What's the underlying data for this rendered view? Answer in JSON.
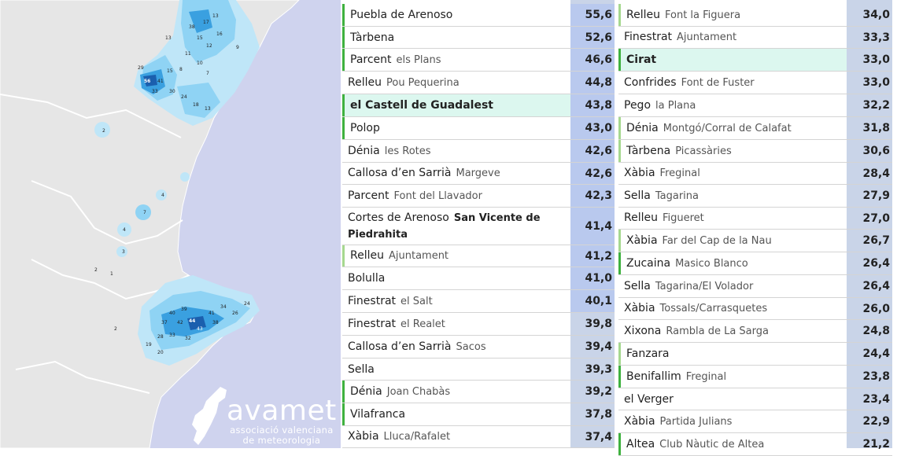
{
  "logo": {
    "name": "avamet",
    "subtitle_1": "associació valenciana",
    "subtitle_2": "de meteorologia"
  },
  "colors": {
    "map_bg": "#cfd3ee",
    "land": "#e6e6e6",
    "rain_light": "#8fd3f4",
    "rain_mid": "#3aa0e0",
    "rain_dark": "#1b5fae",
    "row_highlight": "#dcf7ef",
    "value_col": "#c9d4e8",
    "marker_green": "#3fb13f",
    "marker_light_green": "#a6d88f"
  },
  "left_rows": [
    {
      "name": "Puebla de Arenoso",
      "station": "",
      "value": "55,6",
      "marker": "green",
      "highlight": false,
      "bold": false
    },
    {
      "name": "Tàrbena",
      "station": "",
      "value": "52,6",
      "marker": "green",
      "highlight": false,
      "bold": false
    },
    {
      "name": "Parcent",
      "station": "els Plans",
      "value": "46,6",
      "marker": "green",
      "highlight": false,
      "bold": false
    },
    {
      "name": "Relleu",
      "station": "Pou Pequerina",
      "value": "44,8",
      "marker": "none",
      "highlight": false,
      "bold": false
    },
    {
      "name": "el Castell de Guadalest",
      "station": "",
      "value": "43,8",
      "marker": "green",
      "highlight": true,
      "bold": true
    },
    {
      "name": "Polop",
      "station": "",
      "value": "43,0",
      "marker": "green",
      "highlight": false,
      "bold": false
    },
    {
      "name": "Dénia",
      "station": "les Rotes",
      "value": "42,6",
      "marker": "none",
      "highlight": false,
      "bold": false
    },
    {
      "name": "Callosa d’en Sarrià",
      "station": "Margeve",
      "value": "42,6",
      "marker": "none",
      "highlight": false,
      "bold": false
    },
    {
      "name": "Parcent",
      "station": "Font del Llavador",
      "value": "42,3",
      "marker": "none",
      "highlight": false,
      "bold": false
    },
    {
      "name": "Cortes de Arenoso",
      "station": "San Vicente de Piedrahita",
      "value": "41,4",
      "marker": "none",
      "highlight": false,
      "bold": false,
      "station_bold": true
    },
    {
      "name": "Relleu",
      "station": "Ajuntament",
      "value": "41,2",
      "marker": "lgreen",
      "highlight": false,
      "bold": false
    },
    {
      "name": "Bolulla",
      "station": "",
      "value": "41,0",
      "marker": "none",
      "highlight": false,
      "bold": false
    },
    {
      "name": "Finestrat",
      "station": "el Salt",
      "value": "40,1",
      "marker": "none",
      "highlight": false,
      "bold": false
    },
    {
      "name": "Finestrat",
      "station": "el Realet",
      "value": "39,8",
      "marker": "none",
      "highlight": false,
      "bold": false
    },
    {
      "name": "Callosa d’en Sarrià",
      "station": "Sacos",
      "value": "39,4",
      "marker": "none",
      "highlight": false,
      "bold": false
    },
    {
      "name": "Sella",
      "station": "",
      "value": "39,3",
      "marker": "none",
      "highlight": false,
      "bold": false
    },
    {
      "name": "Dénia",
      "station": "Joan Chabàs",
      "value": "39,2",
      "marker": "green",
      "highlight": false,
      "bold": false
    },
    {
      "name": "Vilafranca",
      "station": "",
      "value": "37,8",
      "marker": "green",
      "highlight": false,
      "bold": false
    },
    {
      "name": "Xàbia",
      "station": "Lluca/Rafalet",
      "value": "37,4",
      "marker": "none",
      "highlight": false,
      "bold": false
    }
  ],
  "right_rows": [
    {
      "name": "Relleu",
      "station": "Font la Figuera",
      "value": "34,0",
      "marker": "lgreen",
      "highlight": false,
      "bold": false
    },
    {
      "name": "Finestrat",
      "station": "Ajuntament",
      "value": "33,3",
      "marker": "none",
      "highlight": false,
      "bold": false
    },
    {
      "name": "Cirat",
      "station": "",
      "value": "33,0",
      "marker": "green",
      "highlight": true,
      "bold": true
    },
    {
      "name": "Confrides",
      "station": "Font de Fuster",
      "value": "33,0",
      "marker": "none",
      "highlight": false,
      "bold": false
    },
    {
      "name": "Pego",
      "station": "la Plana",
      "value": "32,2",
      "marker": "none",
      "highlight": false,
      "bold": false
    },
    {
      "name": "Dénia",
      "station": "Montgó/Corral de Calafat",
      "value": "31,8",
      "marker": "lgreen",
      "highlight": false,
      "bold": false
    },
    {
      "name": "Tàrbena",
      "station": "Picassàries",
      "value": "30,6",
      "marker": "lgreen",
      "highlight": false,
      "bold": false
    },
    {
      "name": "Xàbia",
      "station": "Freginal",
      "value": "28,4",
      "marker": "none",
      "highlight": false,
      "bold": false
    },
    {
      "name": "Sella",
      "station": "Tagarina",
      "value": "27,9",
      "marker": "none",
      "highlight": false,
      "bold": false
    },
    {
      "name": "Relleu",
      "station": "Figueret",
      "value": "27,0",
      "marker": "none",
      "highlight": false,
      "bold": false
    },
    {
      "name": "Xàbia",
      "station": "Far del Cap de la Nau",
      "value": "26,7",
      "marker": "lgreen",
      "highlight": false,
      "bold": false
    },
    {
      "name": "Zucaina",
      "station": "Masico Blanco",
      "value": "26,4",
      "marker": "green",
      "highlight": false,
      "bold": false
    },
    {
      "name": "Sella",
      "station": "Tagarina/El Volador",
      "value": "26,4",
      "marker": "none",
      "highlight": false,
      "bold": false
    },
    {
      "name": "Xàbia",
      "station": "Tossals/Carrasquetes",
      "value": "26,0",
      "marker": "none",
      "highlight": false,
      "bold": false
    },
    {
      "name": "Xixona",
      "station": "Rambla de La Sarga",
      "value": "24,8",
      "marker": "none",
      "highlight": false,
      "bold": false
    },
    {
      "name": "Fanzara",
      "station": "",
      "value": "24,4",
      "marker": "lgreen",
      "highlight": false,
      "bold": false
    },
    {
      "name": "Benifallim",
      "station": "Freginal",
      "value": "23,8",
      "marker": "green",
      "highlight": false,
      "bold": false
    },
    {
      "name": "el Verger",
      "station": "",
      "value": "23,4",
      "marker": "none",
      "highlight": false,
      "bold": false
    },
    {
      "name": "Xàbia",
      "station": "Partida Julians",
      "value": "22,9",
      "marker": "none",
      "highlight": false,
      "bold": false
    },
    {
      "name": "Altea",
      "station": "Club Nàutic de Altea",
      "value": "21,2",
      "marker": "green",
      "highlight": false,
      "bold": false
    }
  ],
  "map_labels": {
    "north_cluster": [
      "38",
      "17",
      "13",
      "15",
      "16",
      "12",
      "11",
      "10",
      "9",
      "8",
      "7",
      "6",
      "5"
    ],
    "west_cluster": [
      "56",
      "41",
      "33",
      "30",
      "24",
      "18",
      "15",
      "13"
    ],
    "south_cluster": [
      "44",
      "43",
      "42",
      "41",
      "40",
      "39",
      "38",
      "37",
      "34",
      "33",
      "32",
      "28",
      "26",
      "24",
      "20"
    ],
    "scattered": [
      "2",
      "3",
      "4",
      "1"
    ]
  }
}
